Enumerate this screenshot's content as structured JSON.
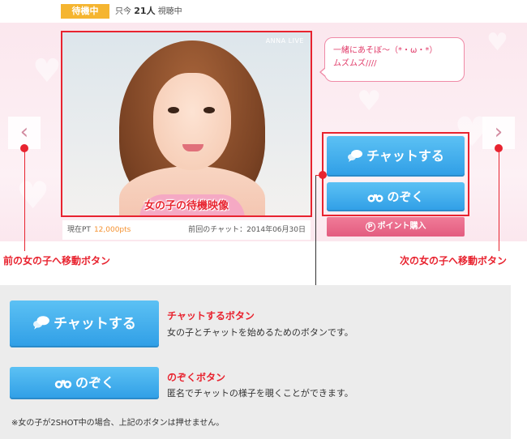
{
  "status": {
    "badge": "待機中",
    "viewers_prefix": "只今",
    "viewers_count": "21人",
    "viewers_suffix": "視聴中"
  },
  "video": {
    "watermark": "ANNA LIVE",
    "label": "女の子の待機映像",
    "current_pt_label": "現在PT",
    "current_pt_value": "12,000pts",
    "last_chat": "前回のチャット：2014年06月30日"
  },
  "bubble": {
    "line1": "一緒にあそぼ～（*・ω・*）",
    "line2": "ムズムズ////"
  },
  "buttons": {
    "chat": "チャットする",
    "peek": "のぞく",
    "points": "ポイント購入",
    "points_icon": "P",
    "prev_glyph": "‹",
    "next_glyph": "›"
  },
  "callouts": {
    "prev": "前の女の子へ移動ボタン",
    "next": "次の女の子へ移動ボタン"
  },
  "panel": {
    "chat_title": "チャットするボタン",
    "chat_desc": "女の子とチャットを始めるためのボタンです。",
    "peek_title": "のぞくボタン",
    "peek_desc": "匿名でチャットの様子を覗くことができます。",
    "note": "※女の子が2SHOT中の場合、上記のボタンは押せません。"
  },
  "icons": {
    "chat": "chat-bubbles-icon",
    "peek": "binoculars-icon",
    "points": "points-coin-icon"
  },
  "colors": {
    "accent_red": "#e8232f",
    "button_blue": "#2f9ee6",
    "button_pink": "#e35c80",
    "badge_orange": "#f5b530"
  }
}
